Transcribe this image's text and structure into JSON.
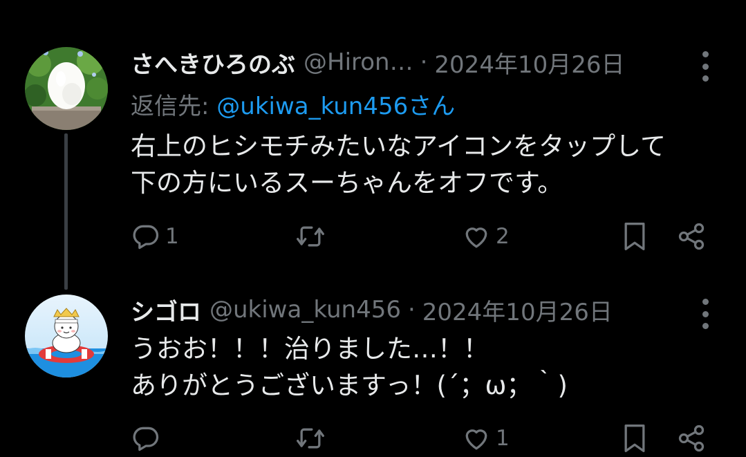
{
  "tweets": [
    {
      "name": "さへきひろのぶ",
      "handle": "@Hiron…",
      "dot": "·",
      "date": "2024年10月26日",
      "replying_label": "返信先: ",
      "replying_mention": "@ukiwa_kun456さん",
      "text_lines": [
        "右上のヒシモチみたいなアイコンをタップして",
        "下の方にいるスーちゃんをオフです。"
      ],
      "reply_count": "1",
      "retweet_count": "",
      "like_count": "2",
      "avatar_icon": "egg-avatar-icon"
    },
    {
      "name": "シゴロ",
      "handle": "@ukiwa_kun456",
      "dot": "·",
      "date": "2024年10月26日",
      "text_lines": [
        "うおお！！！治りました…！！",
        "ありがとうございますっ！(´；ω；｀)"
      ],
      "reply_count": "",
      "retweet_count": "",
      "like_count": "1",
      "avatar_icon": "swim-ring-character-avatar-icon"
    }
  ],
  "icons": {
    "reply": "reply-icon",
    "retweet": "retweet-icon",
    "like": "heart-icon",
    "bookmark": "bookmark-icon",
    "share": "share-icon",
    "more": "more-options-icon"
  },
  "colors": {
    "background": "#000000",
    "text": "#e7e9ea",
    "muted": "#71767b",
    "link": "#1d9bf0",
    "thread_line": "#3a3f44"
  }
}
